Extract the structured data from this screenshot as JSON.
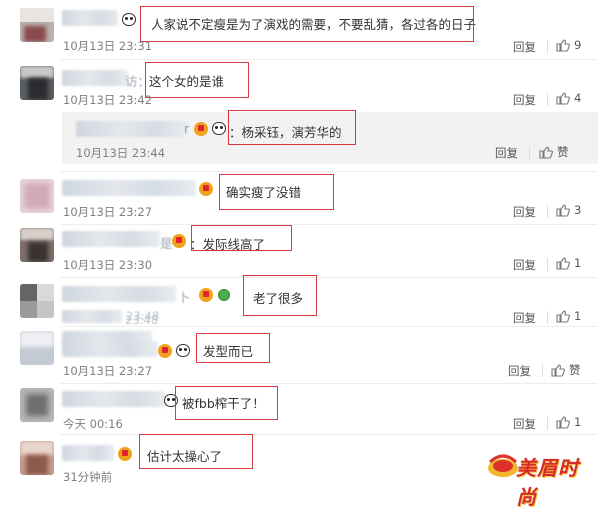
{
  "comments": [
    {
      "text": "人家说不定瘦是为了演戏的需要，不要乱猜，各过各的日子",
      "time": "10月13日 23:31",
      "reply": "回复",
      "likes": "9"
    },
    {
      "text": "这个女的是谁",
      "time": "10月13日 23:42",
      "reply": "回复",
      "likes": "4"
    },
    {
      "text": "：杨采钰，演芳华的",
      "time": "10月13日 23:44",
      "reply": "回复",
      "likes": "赞"
    },
    {
      "text": "确实瘦了没错",
      "time": "10月13日 23:27",
      "reply": "回复",
      "likes": "3"
    },
    {
      "text": "：发际线高了",
      "time": "10月13日 23:30",
      "reply": "回复",
      "likes": "1"
    },
    {
      "text": "老了很多",
      "time": "",
      "reply": "回复",
      "likes": "1"
    },
    {
      "text": "发型而已",
      "time": "10月13日 23:27",
      "reply": "回复",
      "likes": "赞"
    },
    {
      "text": "被fbb榨干了！",
      "time": "今天 00:16",
      "reply": "回复",
      "likes": "1"
    },
    {
      "text": "估计太操心了",
      "time": "31分钟前",
      "reply": "",
      "likes": ""
    }
  ],
  "partial_names": {
    "name1_tail": "访：",
    "name2_tail": "r",
    "name5_tail": "是",
    "name6_tail": "卜",
    "name6_time": "23:48",
    "name7_time": "23:48"
  },
  "watermark": "美眉时尚",
  "colors": {
    "highlight_box": "#d33b3b",
    "time_text": "#808080",
    "badge": "#f1a21c"
  }
}
